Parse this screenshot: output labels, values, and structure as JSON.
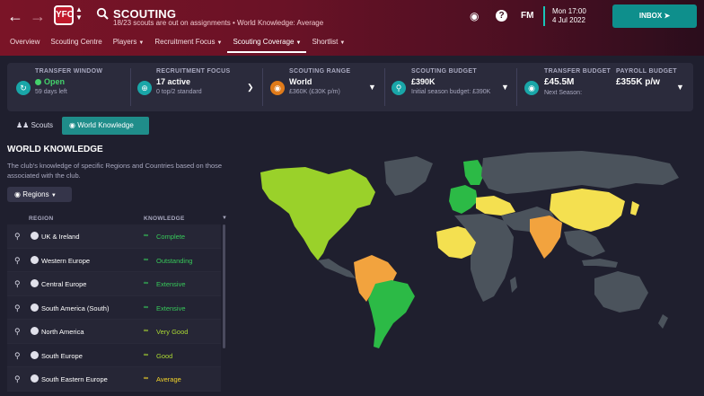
{
  "header": {
    "title": "SCOUTING",
    "subtitle": "18/23 scouts are out on assignments • World Knowledge: Average",
    "club_badge_text": "YFC",
    "fm_logo": "FM",
    "date_top": "Mon 17:00",
    "date_bottom": "4 Jul 2022",
    "inbox_label": "INBOX"
  },
  "tabs": [
    {
      "label": "Overview"
    },
    {
      "label": "Scouting Centre"
    },
    {
      "label": "Players"
    },
    {
      "label": "Recruitment Focus"
    },
    {
      "label": "Scouting Coverage"
    },
    {
      "label": "Shortlist"
    }
  ],
  "infobar": {
    "transfer_window": {
      "label": "TRANSFER WINDOW",
      "value": "Open",
      "sub": "59 days left"
    },
    "recruitment_focus": {
      "label": "RECRUITMENT FOCUS",
      "value": "17 active",
      "sub": "0 top/2 standard"
    },
    "scouting_range": {
      "label": "SCOUTING RANGE",
      "value": "World",
      "sub": "£360K (£30K p/m)"
    },
    "scouting_budget": {
      "label": "SCOUTING BUDGET",
      "value": "£390K",
      "sub": "Initial season budget: £390K"
    },
    "transfer_budget": {
      "label": "TRANSFER BUDGET",
      "value": "£45.5M",
      "sub": "Next Season:"
    },
    "payroll_budget": {
      "label": "PAYROLL BUDGET",
      "value": "£355K p/w"
    }
  },
  "toggle": {
    "scouts": "Scouts",
    "world_knowledge": "World Knowledge"
  },
  "panel": {
    "title": "WORLD KNOWLEDGE",
    "description": "The club's knowledge of specific Regions and Countries based on those associated with the club.",
    "regions_button": "Regions",
    "col_region": "REGION",
    "col_knowledge": "KNOWLEDGE"
  },
  "regions": [
    {
      "name": "UK & Ireland",
      "knowledge": "Complete",
      "color": "#37c95a"
    },
    {
      "name": "Western Europe",
      "knowledge": "Outstanding",
      "color": "#37c95a"
    },
    {
      "name": "Central Europe",
      "knowledge": "Extensive",
      "color": "#37c95a"
    },
    {
      "name": "South America (South)",
      "knowledge": "Extensive",
      "color": "#37c95a"
    },
    {
      "name": "North America",
      "knowledge": "Very Good",
      "color": "#a9d633"
    },
    {
      "name": "South Europe",
      "knowledge": "Good",
      "color": "#a9d633"
    },
    {
      "name": "South Eastern Europe",
      "knowledge": "Average",
      "color": "#f2d32a"
    }
  ],
  "map_colors": {
    "ocean": "#1f1f2e",
    "no_knowledge": "#4b535c",
    "very_good": "#9ad12a",
    "outstanding": "#2cba46",
    "average": "#f4e050",
    "basic": "#f2a33e"
  }
}
